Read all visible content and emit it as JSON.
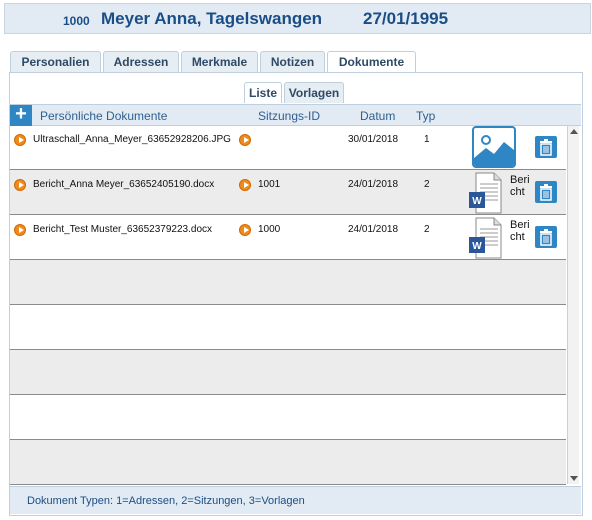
{
  "header": {
    "patient_id": "1000",
    "patient_name": "Meyer Anna, Tagelswangen",
    "birth_date": "27/01/1995"
  },
  "tabs": [
    {
      "label": "Personalien"
    },
    {
      "label": "Adressen"
    },
    {
      "label": "Merkmale"
    },
    {
      "label": "Notizen"
    },
    {
      "label": "Dokumente",
      "active": true
    }
  ],
  "subtabs": [
    {
      "label": "Liste",
      "active": true
    },
    {
      "label": "Vorlagen"
    }
  ],
  "table": {
    "add_icon": "plus-icon",
    "columns": {
      "name": "Persönliche Dokumente",
      "session_id": "Sitzungs-ID",
      "date": "Datum",
      "type": "Typ"
    },
    "rows": [
      {
        "file": "Ultraschall_Anna_Meyer_63652928206.JPG",
        "session_id": "",
        "date": "30/01/2018",
        "type": "1",
        "thumb": "image-icon"
      },
      {
        "file": "Bericht_Anna Meyer_63652405190.docx",
        "session_id": "1001",
        "date": "24/01/2018",
        "type": "2",
        "thumb": "word-doc-icon",
        "thumb_label": "Bericht"
      },
      {
        "file": "Bericht_Test Muster_63652379223.docx",
        "session_id": "1000",
        "date": "24/01/2018",
        "type": "2",
        "thumb": "word-doc-icon",
        "thumb_label": "Bericht"
      }
    ],
    "empty_rows": 5
  },
  "footer": {
    "text": "Dokument Typen: 1=Adressen, 2=Sitzungen, 3=Vorlagen"
  },
  "colors": {
    "accent": "#2f86c5",
    "header_text": "#1b4e86",
    "play": "#f08a1c"
  }
}
